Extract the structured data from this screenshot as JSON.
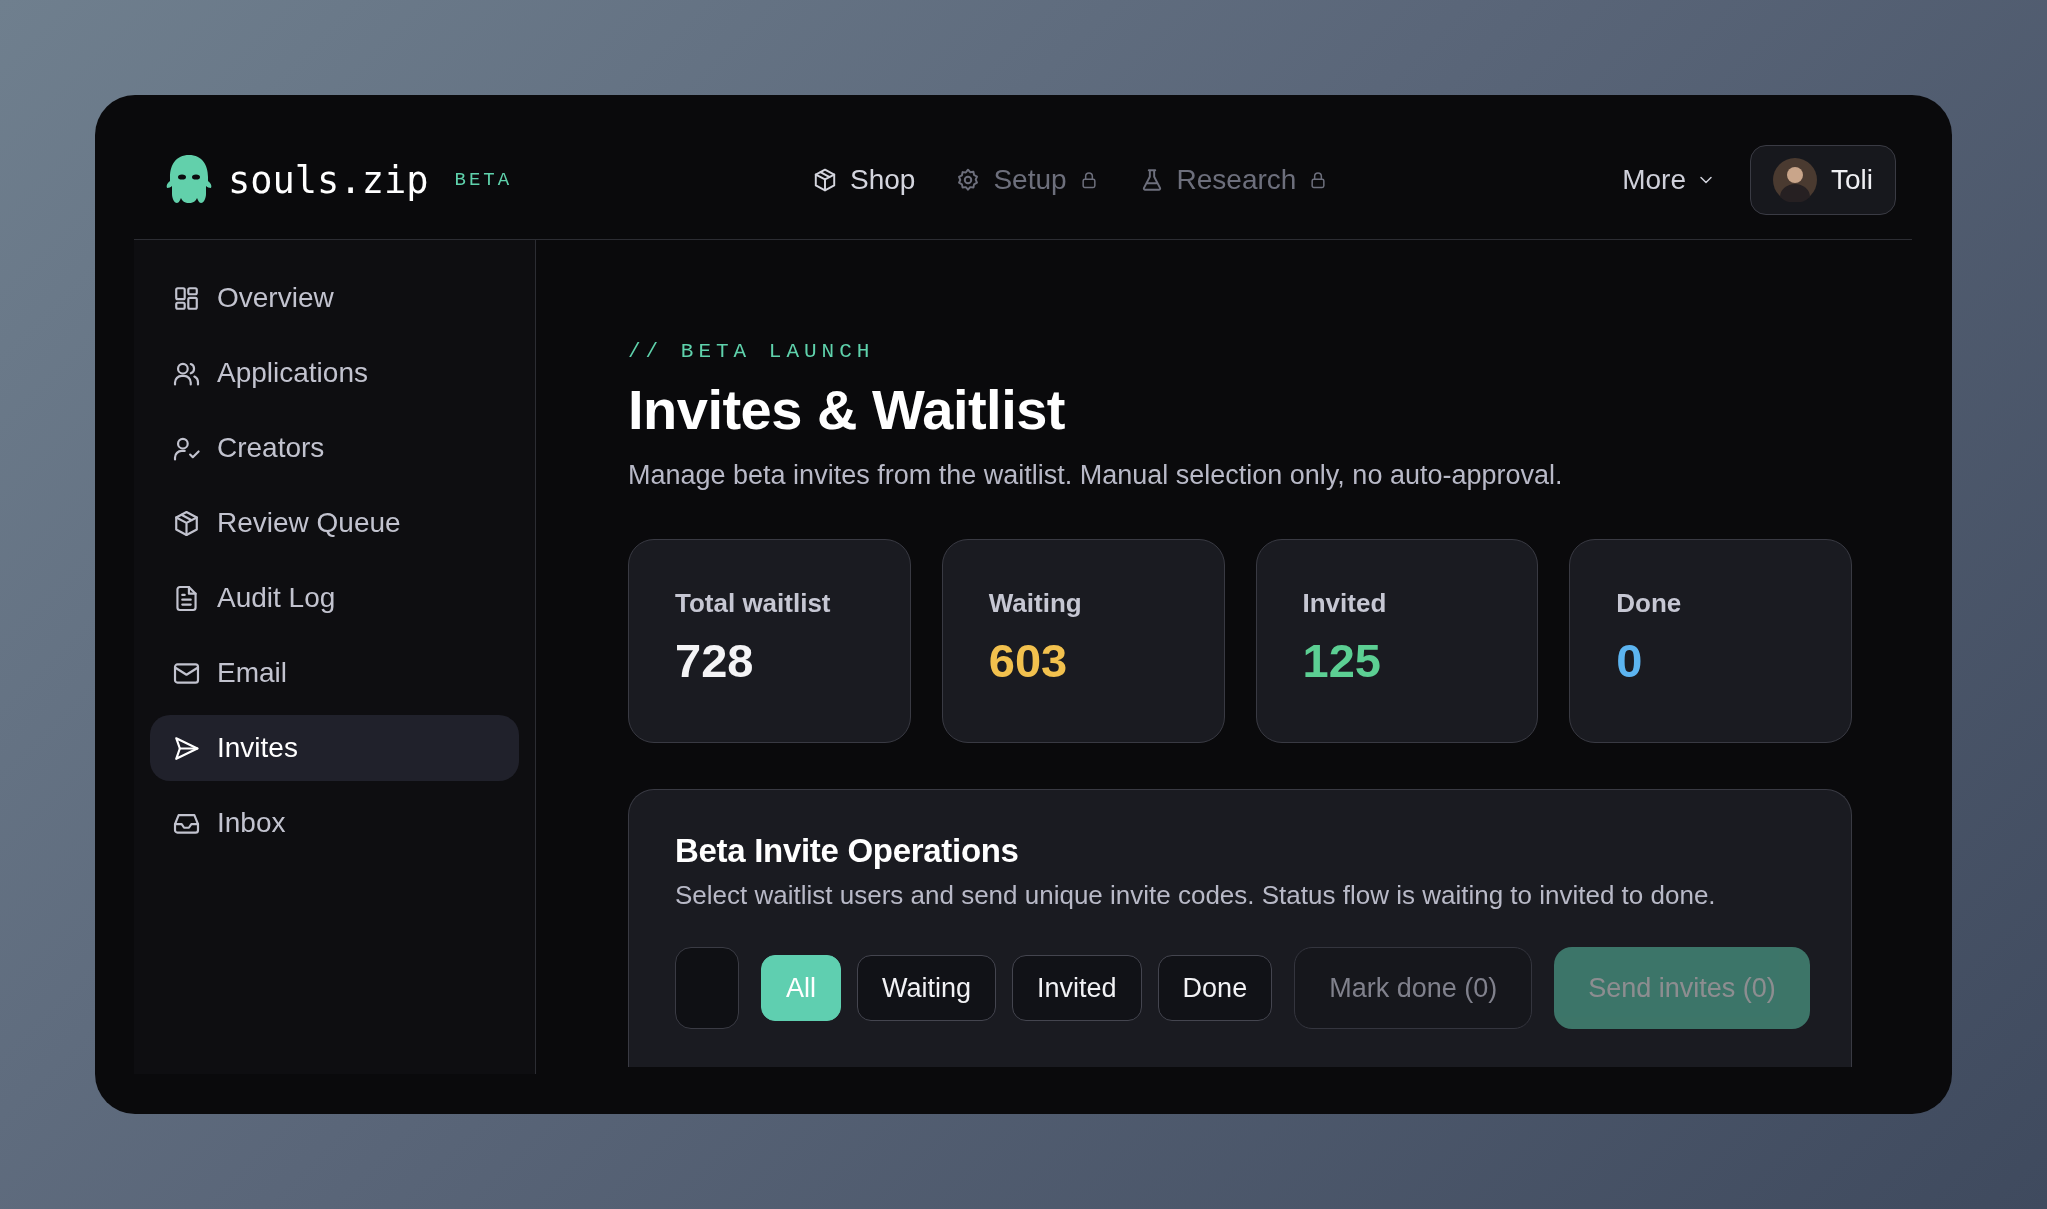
{
  "brand": {
    "name": "souls.zip",
    "badge": "BETA"
  },
  "nav": [
    {
      "label": "Shop",
      "locked": false
    },
    {
      "label": "Setup",
      "locked": true
    },
    {
      "label": "Research",
      "locked": true
    }
  ],
  "more": {
    "label": "More"
  },
  "user": {
    "name": "Toli"
  },
  "sidebar": {
    "items": [
      {
        "label": "Overview",
        "selected": false
      },
      {
        "label": "Applications",
        "selected": false
      },
      {
        "label": "Creators",
        "selected": false
      },
      {
        "label": "Review Queue",
        "selected": false
      },
      {
        "label": "Audit Log",
        "selected": false
      },
      {
        "label": "Email",
        "selected": false
      },
      {
        "label": "Invites",
        "selected": true
      },
      {
        "label": "Inbox",
        "selected": false
      }
    ]
  },
  "page": {
    "eyebrow": "// BETA LAUNCH",
    "title": "Invites & Waitlist",
    "description": "Manage beta invites from the waitlist. Manual selection only, no auto-approval."
  },
  "stats": [
    {
      "label": "Total waitlist",
      "value": "728",
      "color": "#f4f4f6"
    },
    {
      "label": "Waiting",
      "value": "603",
      "color": "#f2c14e"
    },
    {
      "label": "Invited",
      "value": "125",
      "color": "#5ccf93"
    },
    {
      "label": "Done",
      "value": "0",
      "color": "#5cb4f0"
    }
  ],
  "operations": {
    "title": "Beta Invite Operations",
    "description": "Select waitlist users and send unique invite codes. Status flow is waiting to invited to done.",
    "select_all": {
      "checked": false
    },
    "filters": [
      {
        "label": "All",
        "selected": true
      },
      {
        "label": "Waiting",
        "selected": false
      },
      {
        "label": "Invited",
        "selected": false
      },
      {
        "label": "Done",
        "selected": false
      }
    ],
    "actions": [
      {
        "label": "Mark done (0)",
        "kind": "secondary",
        "disabled": true
      },
      {
        "label": "Send invites (0)",
        "kind": "primary",
        "disabled": true
      }
    ]
  }
}
